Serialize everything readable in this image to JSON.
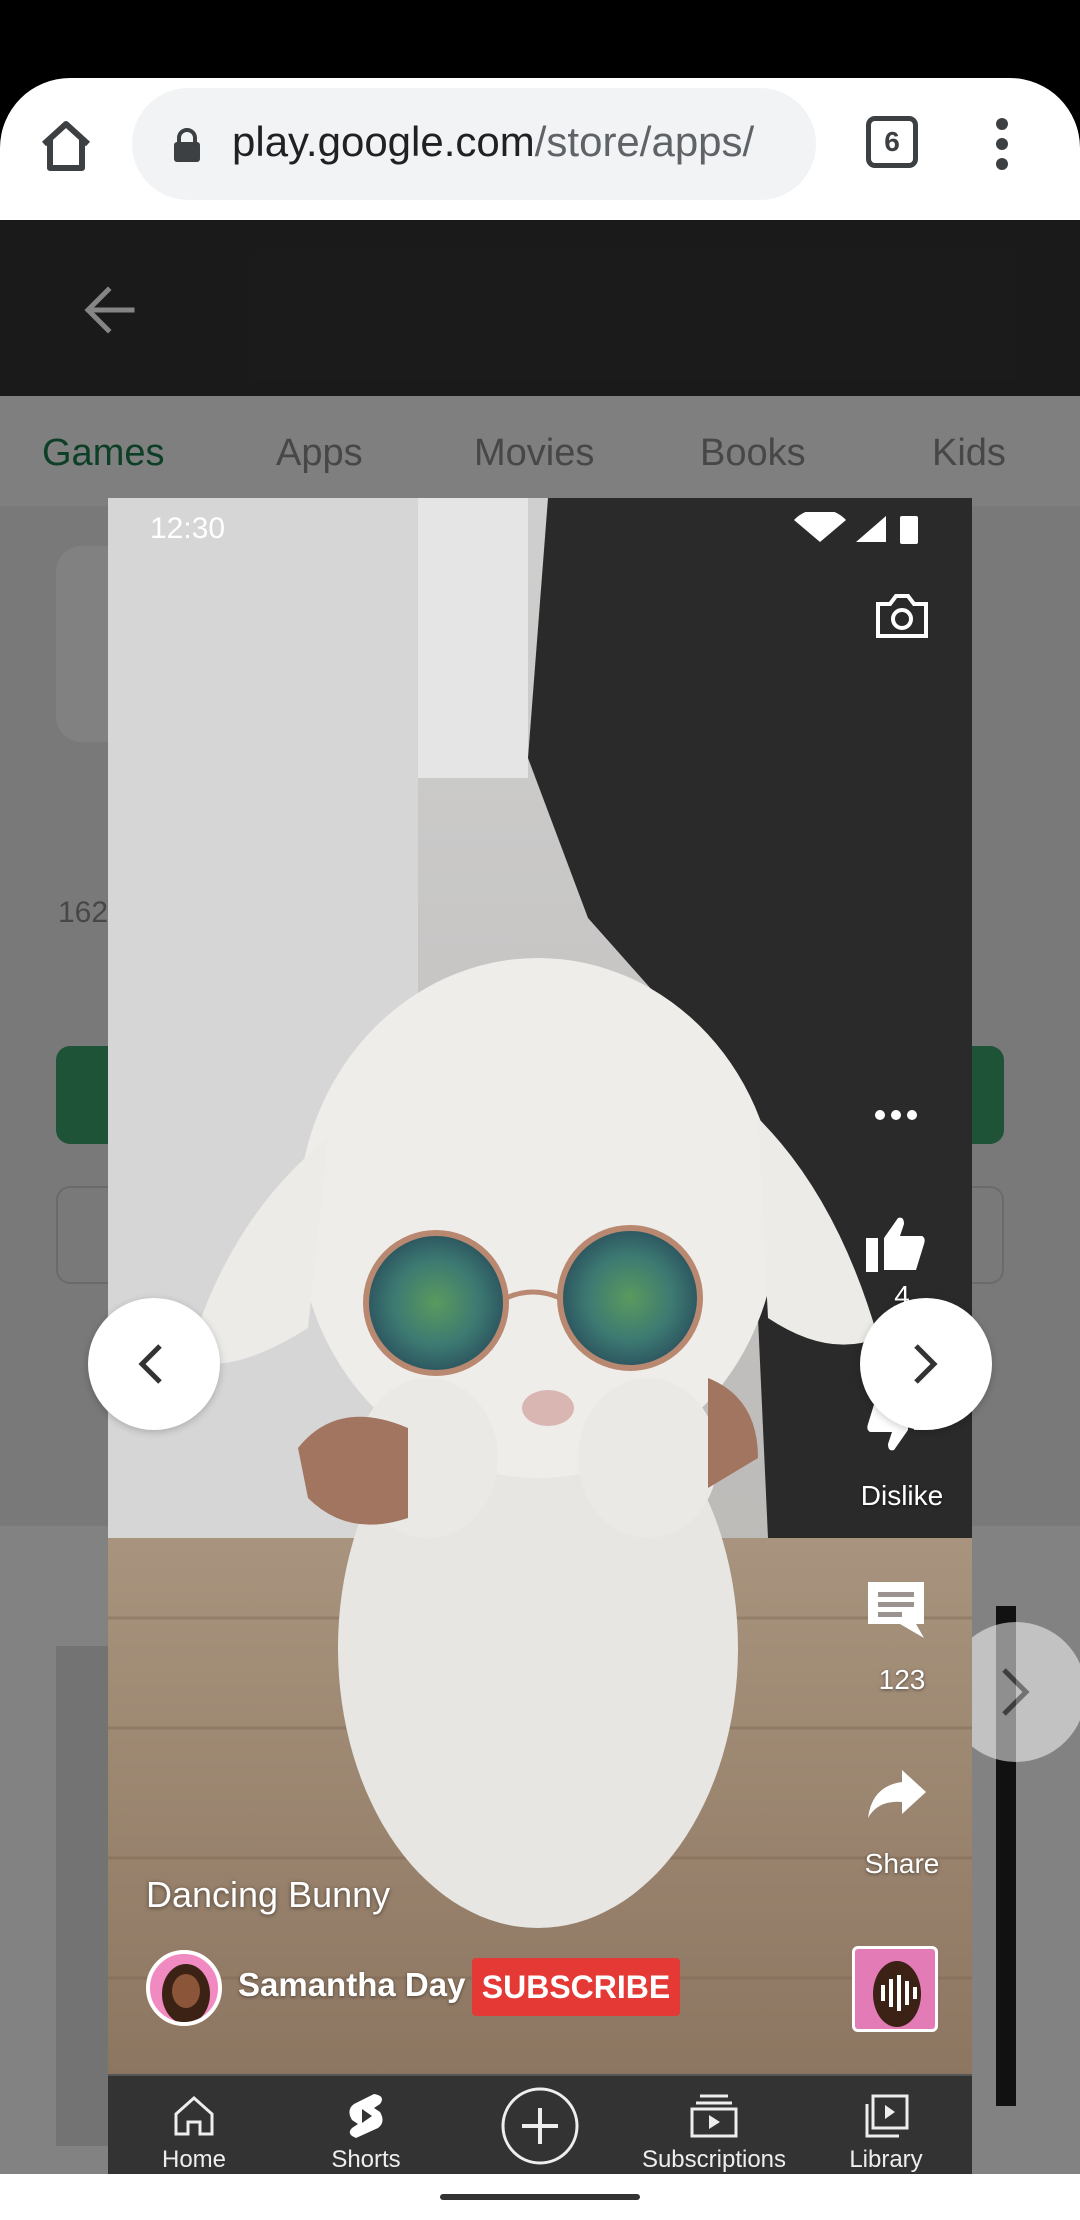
{
  "browser": {
    "url_host": "play.google.com",
    "url_path": "/store/apps/",
    "tab_count": "6"
  },
  "play_store": {
    "tabs": [
      {
        "label": "Games",
        "active": true
      },
      {
        "label": "Apps",
        "active": false
      },
      {
        "label": "Movies",
        "active": false
      },
      {
        "label": "Books",
        "active": false
      },
      {
        "label": "Kids",
        "active": false
      }
    ],
    "partial_count": "162"
  },
  "preview": {
    "status_time": "12:30",
    "actions": {
      "more": "…",
      "like_count": "4",
      "dislike_label": "Dislike",
      "comment_count": "123",
      "share_label": "Share"
    },
    "video_title": "Dancing Bunny",
    "channel_name": "Samantha Day",
    "subscribe_label": "SUBSCRIBE",
    "nav": [
      {
        "label": "Home",
        "icon": "home-icon"
      },
      {
        "label": "Shorts",
        "icon": "shorts-icon"
      },
      {
        "label": "",
        "icon": "create-icon"
      },
      {
        "label": "Subscriptions",
        "icon": "subscriptions-icon"
      },
      {
        "label": "Library",
        "icon": "library-icon"
      }
    ]
  },
  "colors": {
    "play_green": "#1a7a4c",
    "subscribe_red": "#e53935"
  }
}
